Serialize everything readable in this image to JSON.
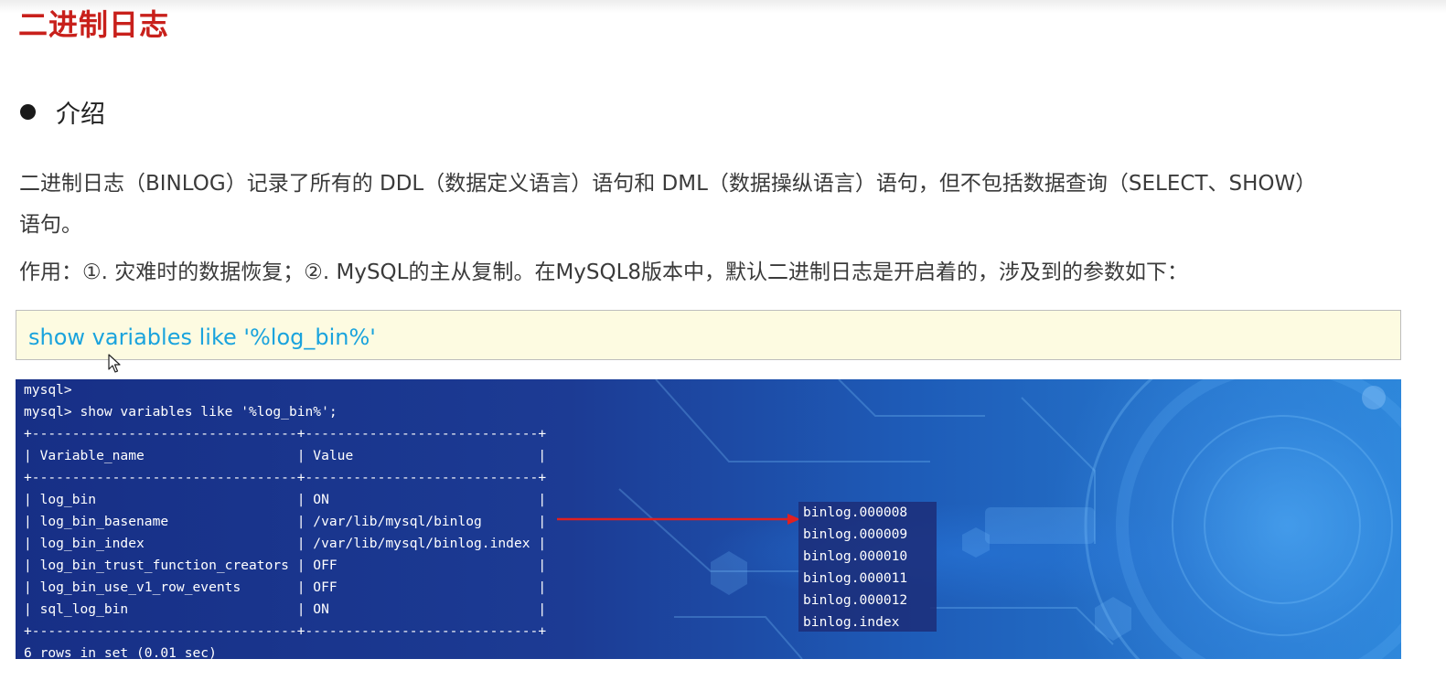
{
  "title": "二进制日志",
  "section": {
    "label": "介绍"
  },
  "paragraphs": {
    "p1": "二进制日志（BINLOG）记录了所有的 DDL（数据定义语言）语句和 DML（数据操纵语言）语句，但不包括数据查询（SELECT、SHOW）",
    "p2": "语句。",
    "p3": "作用：①. 灾难时的数据恢复；②. MySQL的主从复制。在MySQL8版本中，默认二进制日志是开启着的，涉及到的参数如下："
  },
  "code": {
    "text": "show variables like '%log_bin%'"
  },
  "terminal": {
    "lines": [
      "mysql>",
      "mysql> show variables like '%log_bin%';",
      "+---------------------------------+-----------------------------+",
      "| Variable_name                   | Value                       |",
      "+---------------------------------+-----------------------------+",
      "| log_bin                         | ON                          |",
      "| log_bin_basename                | /var/lib/mysql/binlog       |",
      "| log_bin_index                   | /var/lib/mysql/binlog.index |",
      "| log_bin_trust_function_creators | OFF                         |",
      "| log_bin_use_v1_row_events       | OFF                         |",
      "| sql_log_bin                     | ON                          |",
      "+---------------------------------+-----------------------------+",
      "6 rows in set (0.01 sec)"
    ],
    "binlog_files": [
      "binlog.000008",
      "binlog.000009",
      "binlog.000010",
      "binlog.000011",
      "binlog.000012",
      "binlog.index"
    ]
  },
  "colors": {
    "title": "#c8201b",
    "code_text": "#1aa3dd",
    "code_bg": "#fdfbe1",
    "arrow": "#e02020",
    "terminal_bg": "#1c3b94"
  },
  "icons": {
    "cursor": "mouse-pointer-icon",
    "arrow": "arrow-right-icon"
  }
}
